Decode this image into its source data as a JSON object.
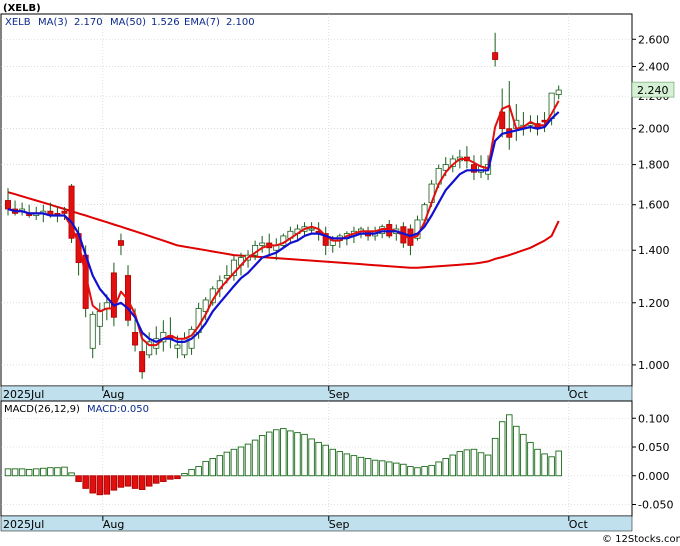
{
  "chart_data": [
    {
      "type": "candlestick",
      "title": "(XELB)",
      "legend": {
        "symbol": "XELB",
        "ma3_label": "MA(3)",
        "ma3_value": "2.170",
        "ma50_label": "MA(50)",
        "ma50_value": "1.526",
        "ema7_label": "EMA(7)",
        "ema7_value": "2.100"
      },
      "last_price_tag": "2.240",
      "y_ticks": [
        "2.600",
        "2.400",
        "2.200",
        "2.000",
        "1.800",
        "1.600",
        "1.400",
        "1.200",
        "1.000"
      ],
      "y_tick_values": [
        2.6,
        2.4,
        2.2,
        2.0,
        1.8,
        1.6,
        1.4,
        1.2,
        1.0
      ],
      "x_labels": [
        {
          "text": "2025Jul",
          "index": 0
        },
        {
          "text": "Aug",
          "index": 14
        },
        {
          "text": "Sep",
          "index": 46
        },
        {
          "text": "Oct",
          "index": 80
        }
      ],
      "y_scale": "log",
      "ylim": [
        0.94,
        2.8
      ],
      "grid": true,
      "candles": [
        [
          1.62,
          1.68,
          1.55,
          1.58
        ],
        [
          1.58,
          1.62,
          1.55,
          1.56
        ],
        [
          1.57,
          1.61,
          1.55,
          1.58
        ],
        [
          1.56,
          1.6,
          1.54,
          1.55
        ],
        [
          1.55,
          1.59,
          1.53,
          1.56
        ],
        [
          1.56,
          1.6,
          1.52,
          1.57
        ],
        [
          1.57,
          1.61,
          1.54,
          1.55
        ],
        [
          1.56,
          1.59,
          1.52,
          1.55
        ],
        [
          1.57,
          1.59,
          1.53,
          1.56
        ],
        [
          1.69,
          1.7,
          1.43,
          1.45
        ],
        [
          1.47,
          1.5,
          1.3,
          1.35
        ],
        [
          1.38,
          1.42,
          1.15,
          1.18
        ],
        [
          1.05,
          1.17,
          1.02,
          1.16
        ],
        [
          1.12,
          1.2,
          1.06,
          1.17
        ],
        [
          1.18,
          1.23,
          1.14,
          1.2
        ],
        [
          1.31,
          1.35,
          1.12,
          1.15
        ],
        [
          1.44,
          1.47,
          1.38,
          1.42
        ],
        [
          1.3,
          1.34,
          1.12,
          1.14
        ],
        [
          1.1,
          1.18,
          1.04,
          1.06
        ],
        [
          1.04,
          1.1,
          0.96,
          0.98
        ],
        [
          1.03,
          1.1,
          1.02,
          1.07
        ],
        [
          1.05,
          1.12,
          1.03,
          1.08
        ],
        [
          1.07,
          1.14,
          1.04,
          1.1
        ],
        [
          1.09,
          1.15,
          1.05,
          1.08
        ],
        [
          1.05,
          1.09,
          1.02,
          1.06
        ],
        [
          1.03,
          1.1,
          1.02,
          1.08
        ],
        [
          1.05,
          1.12,
          1.03,
          1.11
        ],
        [
          1.1,
          1.2,
          1.08,
          1.18
        ],
        [
          1.17,
          1.22,
          1.14,
          1.21
        ],
        [
          1.2,
          1.26,
          1.19,
          1.25
        ],
        [
          1.25,
          1.3,
          1.22,
          1.28
        ],
        [
          1.29,
          1.34,
          1.27,
          1.3
        ],
        [
          1.3,
          1.38,
          1.28,
          1.36
        ],
        [
          1.34,
          1.39,
          1.3,
          1.37
        ],
        [
          1.36,
          1.4,
          1.33,
          1.38
        ],
        [
          1.38,
          1.44,
          1.36,
          1.42
        ],
        [
          1.42,
          1.46,
          1.39,
          1.43
        ],
        [
          1.43,
          1.47,
          1.38,
          1.41
        ],
        [
          1.4,
          1.45,
          1.36,
          1.42
        ],
        [
          1.42,
          1.47,
          1.41,
          1.46
        ],
        [
          1.45,
          1.5,
          1.43,
          1.48
        ],
        [
          1.47,
          1.51,
          1.44,
          1.49
        ],
        [
          1.48,
          1.52,
          1.46,
          1.5
        ],
        [
          1.49,
          1.52,
          1.47,
          1.49
        ],
        [
          1.48,
          1.52,
          1.44,
          1.47
        ],
        [
          1.47,
          1.5,
          1.38,
          1.42
        ],
        [
          1.42,
          1.46,
          1.39,
          1.44
        ],
        [
          1.44,
          1.47,
          1.41,
          1.46
        ],
        [
          1.45,
          1.48,
          1.42,
          1.47
        ],
        [
          1.46,
          1.5,
          1.43,
          1.48
        ],
        [
          1.47,
          1.5,
          1.45,
          1.49
        ],
        [
          1.48,
          1.5,
          1.44,
          1.46
        ],
        [
          1.46,
          1.5,
          1.44,
          1.48
        ],
        [
          1.47,
          1.51,
          1.45,
          1.5
        ],
        [
          1.51,
          1.53,
          1.45,
          1.46
        ],
        [
          1.47,
          1.51,
          1.44,
          1.49
        ],
        [
          1.5,
          1.52,
          1.41,
          1.43
        ],
        [
          1.49,
          1.51,
          1.38,
          1.42
        ],
        [
          1.45,
          1.55,
          1.44,
          1.53
        ],
        [
          1.53,
          1.61,
          1.51,
          1.6
        ],
        [
          1.61,
          1.72,
          1.59,
          1.7
        ],
        [
          1.7,
          1.8,
          1.68,
          1.78
        ],
        [
          1.77,
          1.84,
          1.74,
          1.8
        ],
        [
          1.79,
          1.85,
          1.76,
          1.83
        ],
        [
          1.82,
          1.88,
          1.78,
          1.84
        ],
        [
          1.84,
          1.9,
          1.78,
          1.82
        ],
        [
          1.8,
          1.85,
          1.72,
          1.76
        ],
        [
          1.76,
          1.85,
          1.73,
          1.79
        ],
        [
          1.75,
          1.85,
          1.72,
          1.8
        ],
        [
          2.5,
          2.65,
          2.4,
          2.45
        ],
        [
          2.1,
          2.25,
          1.95,
          2.0
        ],
        [
          2.0,
          2.3,
          1.88,
          1.95
        ],
        [
          2.0,
          2.15,
          1.93,
          2.05
        ],
        [
          2.0,
          2.1,
          1.96,
          2.02
        ],
        [
          2.02,
          2.08,
          1.98,
          2.03
        ],
        [
          2.03,
          2.08,
          1.96,
          2.0
        ],
        [
          2.05,
          2.1,
          1.98,
          2.04
        ],
        [
          2.06,
          2.2,
          2.02,
          2.22
        ],
        [
          2.21,
          2.27,
          2.18,
          2.24
        ]
      ],
      "ma3": [
        1.58,
        1.57,
        1.57,
        1.56,
        1.56,
        1.56,
        1.55,
        1.55,
        1.55,
        1.5,
        1.43,
        1.3,
        1.19,
        1.17,
        1.18,
        1.18,
        1.24,
        1.21,
        1.16,
        1.08,
        1.06,
        1.06,
        1.08,
        1.09,
        1.08,
        1.08,
        1.09,
        1.12,
        1.16,
        1.21,
        1.25,
        1.28,
        1.31,
        1.34,
        1.37,
        1.39,
        1.41,
        1.42,
        1.42,
        1.43,
        1.45,
        1.47,
        1.49,
        1.5,
        1.49,
        1.46,
        1.44,
        1.44,
        1.46,
        1.47,
        1.48,
        1.48,
        1.48,
        1.49,
        1.49,
        1.48,
        1.46,
        1.45,
        1.46,
        1.52,
        1.61,
        1.7,
        1.76,
        1.8,
        1.83,
        1.83,
        1.81,
        1.79,
        1.78,
        2.01,
        2.12,
        2.14,
        2.0,
        2.01,
        2.04,
        2.02,
        2.02,
        2.09,
        2.17
      ],
      "ema7": [
        1.58,
        1.57,
        1.57,
        1.56,
        1.56,
        1.56,
        1.55,
        1.55,
        1.55,
        1.52,
        1.47,
        1.38,
        1.3,
        1.25,
        1.22,
        1.19,
        1.2,
        1.18,
        1.15,
        1.1,
        1.08,
        1.07,
        1.08,
        1.08,
        1.07,
        1.07,
        1.08,
        1.1,
        1.13,
        1.17,
        1.2,
        1.23,
        1.26,
        1.29,
        1.31,
        1.34,
        1.37,
        1.38,
        1.39,
        1.41,
        1.43,
        1.44,
        1.46,
        1.47,
        1.47,
        1.46,
        1.45,
        1.45,
        1.45,
        1.46,
        1.47,
        1.47,
        1.47,
        1.48,
        1.48,
        1.48,
        1.47,
        1.46,
        1.47,
        1.5,
        1.55,
        1.61,
        1.67,
        1.71,
        1.75,
        1.77,
        1.77,
        1.77,
        1.77,
        1.93,
        1.97,
        1.98,
        1.99,
        2.0,
        2.01,
        2.0,
        2.01,
        2.06,
        2.1
      ],
      "ma50": [
        1.66,
        1.65,
        1.64,
        1.63,
        1.62,
        1.61,
        1.6,
        1.59,
        1.58,
        1.57,
        1.56,
        1.55,
        1.54,
        1.53,
        1.52,
        1.51,
        1.5,
        1.49,
        1.48,
        1.47,
        1.46,
        1.45,
        1.44,
        1.43,
        1.42,
        1.415,
        1.41,
        1.405,
        1.4,
        1.395,
        1.39,
        1.385,
        1.38,
        1.378,
        1.376,
        1.374,
        1.372,
        1.37,
        1.368,
        1.366,
        1.364,
        1.362,
        1.36,
        1.358,
        1.356,
        1.354,
        1.352,
        1.35,
        1.348,
        1.346,
        1.344,
        1.342,
        1.34,
        1.338,
        1.336,
        1.334,
        1.332,
        1.33,
        1.33,
        1.332,
        1.334,
        1.336,
        1.338,
        1.34,
        1.342,
        1.344,
        1.346,
        1.35,
        1.355,
        1.365,
        1.372,
        1.38,
        1.39,
        1.4,
        1.41,
        1.425,
        1.44,
        1.46,
        1.526
      ]
    },
    {
      "type": "bar",
      "legend": {
        "macd_label": "MACD(26,12,9)",
        "macd_value_label": "MACD:0.050"
      },
      "y_ticks": [
        "0.100",
        "0.050",
        "0.000",
        "-0.050"
      ],
      "y_tick_values": [
        0.1,
        0.05,
        0.0,
        -0.05
      ],
      "ylim": [
        -0.07,
        0.13
      ],
      "grid": true,
      "x_labels": [
        {
          "text": "2025Jul",
          "index": 0
        },
        {
          "text": "Aug",
          "index": 14
        },
        {
          "text": "Sep",
          "index": 46
        },
        {
          "text": "Oct",
          "index": 80
        }
      ],
      "values": [
        0.012,
        0.012,
        0.012,
        0.011,
        0.012,
        0.013,
        0.014,
        0.014,
        0.015,
        0.005,
        -0.01,
        -0.022,
        -0.03,
        -0.033,
        -0.032,
        -0.025,
        -0.02,
        -0.018,
        -0.022,
        -0.024,
        -0.018,
        -0.013,
        -0.01,
        -0.006,
        -0.005,
        0.004,
        0.011,
        0.016,
        0.025,
        0.03,
        0.035,
        0.041,
        0.046,
        0.05,
        0.055,
        0.062,
        0.07,
        0.076,
        0.08,
        0.082,
        0.078,
        0.075,
        0.072,
        0.064,
        0.058,
        0.053,
        0.046,
        0.042,
        0.038,
        0.035,
        0.032,
        0.03,
        0.027,
        0.026,
        0.024,
        0.022,
        0.02,
        0.016,
        0.014,
        0.016,
        0.018,
        0.024,
        0.03,
        0.036,
        0.042,
        0.045,
        0.046,
        0.04,
        0.036,
        0.065,
        0.094,
        0.106,
        0.086,
        0.072,
        0.058,
        0.046,
        0.038,
        0.033,
        0.043
      ]
    }
  ]
}
